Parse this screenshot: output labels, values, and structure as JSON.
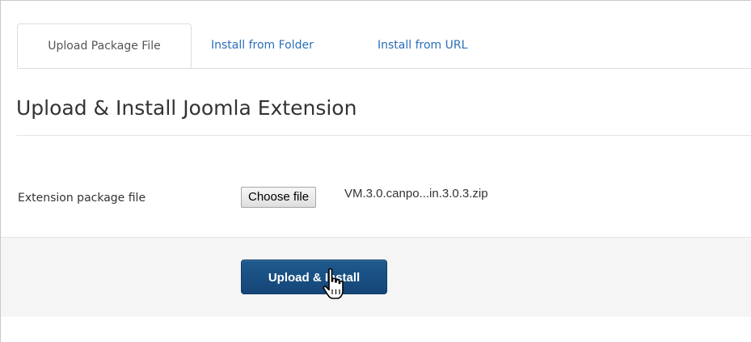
{
  "tabs": [
    {
      "label": "Upload Package File",
      "active": true
    },
    {
      "label": "Install from Folder",
      "active": false
    },
    {
      "label": "Install from URL",
      "active": false
    }
  ],
  "heading": "Upload & Install Joomla Extension",
  "form": {
    "field_label": "Extension package file",
    "choose_file_label": "Choose file",
    "selected_file": "VM.3.0.canpo...in.3.0.3.zip"
  },
  "actions": {
    "upload_install_label": "Upload & Install"
  },
  "cursor": {
    "icon": "hand-pointer-icon"
  },
  "colors": {
    "link": "#2a6fb8",
    "primary_button": "#1a4f82",
    "actions_background": "#f5f5f5"
  }
}
